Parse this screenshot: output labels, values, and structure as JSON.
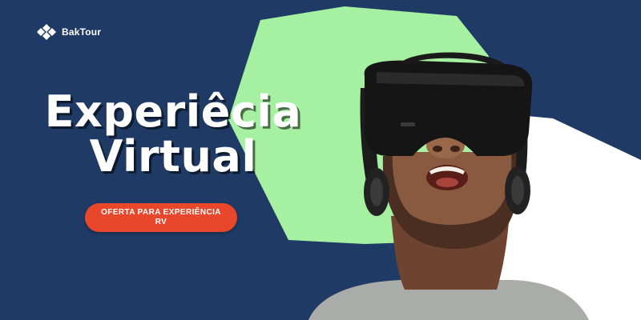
{
  "brand": {
    "name": "BakTour",
    "logo_icon": "diamond-cluster-logo"
  },
  "headline": {
    "line1": "Experiêcia",
    "line2": "Virtual"
  },
  "cta": {
    "line1": "OFERTA PARA EXPERIÊNCIA",
    "line2": "RV"
  },
  "colors": {
    "background": "#1f3a64",
    "green_shape": "#a6f0a1",
    "white_shape": "#ffffff",
    "cta": "#e9472b"
  },
  "image": {
    "subject_icon": "vr-headset-person-image"
  }
}
